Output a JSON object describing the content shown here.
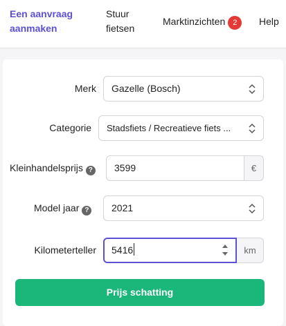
{
  "nav": {
    "create_request": [
      "Een aanvraag",
      "aanmaken"
    ],
    "send_bikes": [
      "Stuur",
      "fietsen"
    ],
    "market_insights": "Marktinzichten",
    "market_insights_badge": "2",
    "help": "Help"
  },
  "form": {
    "brand": {
      "label": "Merk",
      "value": "Gazelle (Bosch)"
    },
    "category": {
      "label": "Categorie",
      "value": "Stadsfiets / Recreatieve fiets ..."
    },
    "retail_price": {
      "label": "Kleinhandelsprijs",
      "value": "3599",
      "addon": "€"
    },
    "model_year": {
      "label": "Model jaar",
      "value": "2021"
    },
    "odometer": {
      "label": "Kilometerteller",
      "value": "5416",
      "addon": "km"
    },
    "submit": "Prijs schatting"
  },
  "colors": {
    "accent": "#5b4fd6",
    "primary_button": "#1bb67a",
    "badge": "#e53935"
  }
}
